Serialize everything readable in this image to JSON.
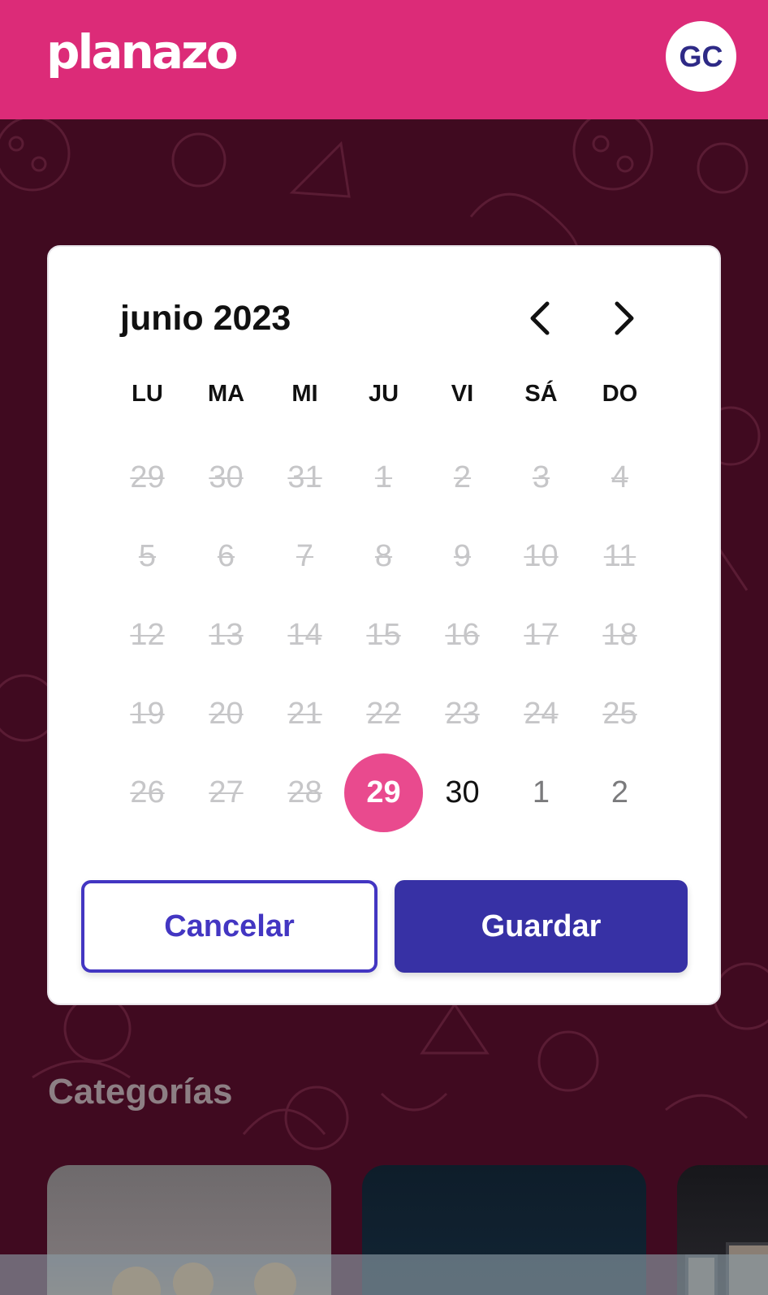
{
  "header": {
    "logo": "planazo",
    "avatar_initials": "GC"
  },
  "colors": {
    "brand": "#dc2b78",
    "selected": "#e94a8e",
    "primary": "#3731a5",
    "outline": "#4336c2"
  },
  "calendar": {
    "month_title": "junio 2023",
    "prev_icon": "chevron-left-icon",
    "next_icon": "chevron-right-icon",
    "weekdays": [
      "LU",
      "MA",
      "MI",
      "JU",
      "VI",
      "SÁ",
      "DO"
    ],
    "weeks": [
      [
        {
          "d": "29",
          "s": "disabled"
        },
        {
          "d": "30",
          "s": "disabled"
        },
        {
          "d": "31",
          "s": "disabled"
        },
        {
          "d": "1",
          "s": "disabled"
        },
        {
          "d": "2",
          "s": "disabled"
        },
        {
          "d": "3",
          "s": "disabled"
        },
        {
          "d": "4",
          "s": "disabled"
        }
      ],
      [
        {
          "d": "5",
          "s": "disabled"
        },
        {
          "d": "6",
          "s": "disabled"
        },
        {
          "d": "7",
          "s": "disabled"
        },
        {
          "d": "8",
          "s": "disabled"
        },
        {
          "d": "9",
          "s": "disabled"
        },
        {
          "d": "10",
          "s": "disabled"
        },
        {
          "d": "11",
          "s": "disabled"
        }
      ],
      [
        {
          "d": "12",
          "s": "disabled"
        },
        {
          "d": "13",
          "s": "disabled"
        },
        {
          "d": "14",
          "s": "disabled"
        },
        {
          "d": "15",
          "s": "disabled"
        },
        {
          "d": "16",
          "s": "disabled"
        },
        {
          "d": "17",
          "s": "disabled"
        },
        {
          "d": "18",
          "s": "disabled"
        }
      ],
      [
        {
          "d": "19",
          "s": "disabled"
        },
        {
          "d": "20",
          "s": "disabled"
        },
        {
          "d": "21",
          "s": "disabled"
        },
        {
          "d": "22",
          "s": "disabled"
        },
        {
          "d": "23",
          "s": "disabled"
        },
        {
          "d": "24",
          "s": "disabled"
        },
        {
          "d": "25",
          "s": "disabled"
        }
      ],
      [
        {
          "d": "26",
          "s": "disabled"
        },
        {
          "d": "27",
          "s": "disabled"
        },
        {
          "d": "28",
          "s": "disabled"
        },
        {
          "d": "29",
          "s": "selected"
        },
        {
          "d": "30",
          "s": "active"
        },
        {
          "d": "1",
          "s": "outside"
        },
        {
          "d": "2",
          "s": "outside"
        }
      ]
    ],
    "cancel_label": "Cancelar",
    "save_label": "Guardar"
  },
  "categories": {
    "title": "Categorías"
  }
}
